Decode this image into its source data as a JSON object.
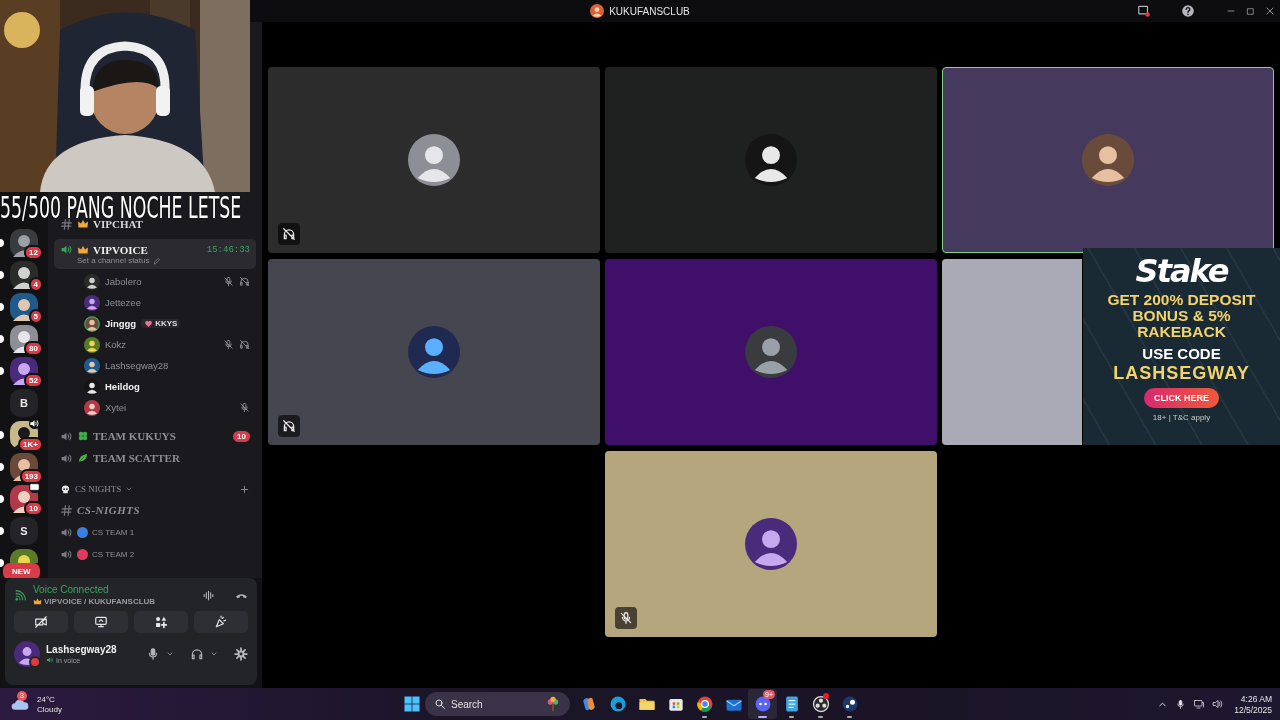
{
  "window": {
    "title": "KUKUFANSCLUB"
  },
  "stream_overlay": {
    "caption": "55/500 PANG NOCHE LETSE"
  },
  "servers": [
    {
      "kind": "avatar",
      "badge": "12",
      "unread": true
    },
    {
      "kind": "avatar",
      "badge": "4",
      "unread": true
    },
    {
      "kind": "avatar",
      "badge": "5",
      "unread": true
    },
    {
      "kind": "avatar",
      "badge": "80",
      "unread": true
    },
    {
      "kind": "avatar",
      "badge": "52",
      "unread": true
    },
    {
      "kind": "letter",
      "letter": "B",
      "unread": false
    },
    {
      "kind": "avatar",
      "badge": "1K+",
      "unread": true
    },
    {
      "kind": "avatar",
      "badge": "193",
      "unread": true
    },
    {
      "kind": "avatar",
      "badge": "10",
      "unread": true
    },
    {
      "kind": "letter",
      "letter": "S",
      "unread": true
    },
    {
      "kind": "promo",
      "badge": "NEW",
      "unread": true
    }
  ],
  "channels": [
    {
      "kind": "text",
      "name": "VIPCHAT",
      "selected": false
    },
    {
      "kind": "voice",
      "name": "VIPVOICE",
      "selected": true,
      "timer": "15:46:33",
      "status": "Set a channel status",
      "members": [
        {
          "name": "Jabolero",
          "muted": true,
          "deafened": true,
          "speaking": false,
          "active": false
        },
        {
          "name": "Jettezee",
          "muted": false,
          "deafened": false,
          "speaking": false,
          "active": false
        },
        {
          "name": "Jinggg",
          "muted": false,
          "deafened": false,
          "speaking": true,
          "active": true,
          "tag": "KKYS"
        },
        {
          "name": "Kokz",
          "muted": true,
          "deafened": true,
          "speaking": false,
          "active": false
        },
        {
          "name": "Lashsegway28",
          "muted": false,
          "deafened": false,
          "speaking": false,
          "active": false
        },
        {
          "name": "Heildog",
          "muted": false,
          "deafened": false,
          "speaking": false,
          "active": true
        },
        {
          "name": "Xytei",
          "muted": true,
          "deafened": false,
          "speaking": false,
          "active": false
        }
      ]
    },
    {
      "kind": "voice",
      "name": "TEAM KUKUYS",
      "selected": false,
      "badge": "10"
    },
    {
      "kind": "voice",
      "name": "TEAM SCATTER",
      "selected": false
    }
  ],
  "category": {
    "name": "CS NIGHTS",
    "expanded": true,
    "channels": [
      {
        "kind": "text",
        "name": "CS-NIGHTS",
        "selected": false
      },
      {
        "kind": "voice",
        "name": "CS TEAM 1",
        "color": "#3b7fe0",
        "selected": false
      },
      {
        "kind": "voice",
        "name": "CS TEAM 2",
        "color": "#e23a5e",
        "selected": false
      }
    ]
  },
  "voice_panel": {
    "title": "Voice Connected",
    "location": "VIPVOICE / KUKUFANSCLUB",
    "buttons": [
      {
        "kind": "camera-off"
      },
      {
        "kind": "screen-share"
      },
      {
        "kind": "activities"
      },
      {
        "kind": "soundboard"
      }
    ]
  },
  "user": {
    "name": "Lashsegway28",
    "status": "In voice"
  },
  "stage": {
    "tiles": [
      {
        "color": "#2b2c2b",
        "selected": false,
        "avatar": true,
        "deafened": true,
        "muted": false
      },
      {
        "color": "#1e2120",
        "selected": false,
        "avatar": true,
        "deafened": false,
        "muted": false
      },
      {
        "color": "#453a5e",
        "selected": true,
        "avatar": true,
        "deafened": false,
        "muted": false
      },
      {
        "color": "#464650",
        "selected": false,
        "avatar": true,
        "deafened": true,
        "muted": false
      },
      {
        "color": "#3f0f6a",
        "selected": false,
        "avatar": true,
        "deafened": false,
        "muted": false
      },
      {
        "color": "#a9aab5",
        "selected": false,
        "avatar": false,
        "deafened": false,
        "muted": false
      },
      {
        "color": "#b6a67e",
        "selected": false,
        "avatar": true,
        "deafened": false,
        "muted": true
      }
    ]
  },
  "ad": {
    "logo": "Stake",
    "headline": "GET 200% DEPOSIT BONUS & 5% RAKEBACK",
    "code_label": "USE CODE",
    "code": "LASHSEGWAY",
    "button": "CLICK HERE",
    "disclaimer": "18+ | T&C apply"
  },
  "taskbar": {
    "weather": {
      "temperature": "24°C",
      "condition": "Cloudy",
      "badge": "3"
    },
    "search": {
      "placeholder": "Search"
    },
    "apps": [
      {
        "kind": "copilot",
        "selected": false,
        "running": false
      },
      {
        "kind": "edge",
        "selected": false,
        "running": false
      },
      {
        "kind": "folder",
        "selected": false,
        "running": false
      },
      {
        "kind": "store",
        "selected": false,
        "running": false
      },
      {
        "kind": "chrome",
        "selected": false,
        "running": true
      },
      {
        "kind": "mail",
        "selected": false,
        "running": false
      },
      {
        "kind": "discord",
        "selected": true,
        "running": true,
        "badge": "9+"
      },
      {
        "kind": "notepad",
        "selected": false,
        "running": true
      },
      {
        "kind": "obs",
        "selected": false,
        "running": true,
        "alert": true
      },
      {
        "kind": "steam",
        "selected": false,
        "running": true
      }
    ],
    "time": "4:26 AM",
    "date": "12/5/2025"
  }
}
